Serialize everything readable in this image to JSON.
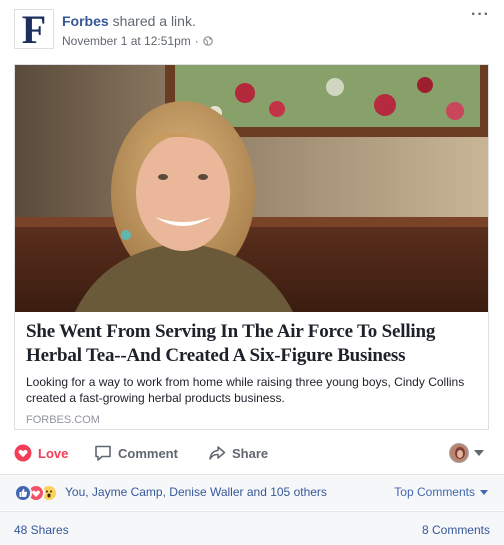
{
  "post": {
    "author": "Forbes",
    "action_text": "shared a link.",
    "timestamp": "November 1 at 12:51pm",
    "separator": "·",
    "privacy_icon": "globe-icon",
    "avatar_letter": "F",
    "more_label": "···"
  },
  "link": {
    "headline": "She Went From Serving In The Air Force To Selling Herbal Tea--And Created A Six-Figure Business",
    "description": "Looking for a way to work from home while raising three young boys, Cindy Collins created a fast-growing herbal products business.",
    "domain": "FORBES.COM"
  },
  "actions": {
    "love_label": "Love",
    "comment_label": "Comment",
    "share_label": "Share"
  },
  "reactions": {
    "names": "You, Jayme Camp, Denise Waller and 105 others",
    "top_comments_label": "Top Comments"
  },
  "counts": {
    "shares": "48 Shares",
    "comments": "8 Comments"
  },
  "colors": {
    "link_blue": "#365899",
    "love_red": "#f33e58",
    "meta_gray": "#616770"
  }
}
